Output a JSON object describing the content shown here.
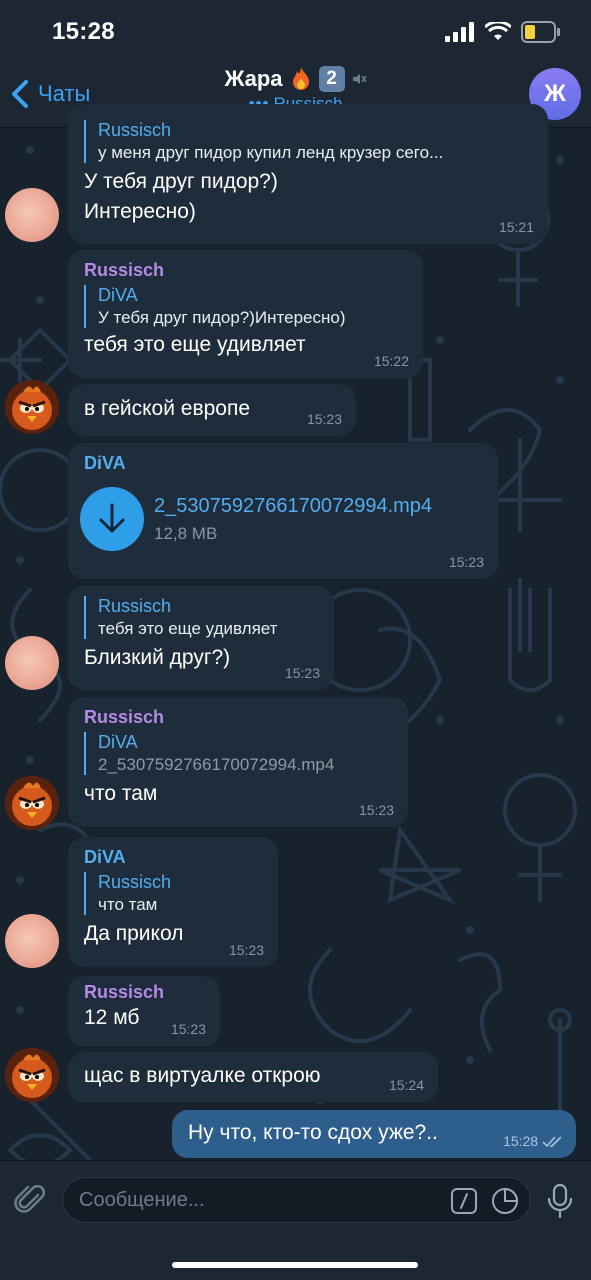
{
  "status": {
    "time": "15:28"
  },
  "header": {
    "back_label": "Чаты",
    "title": "Жара",
    "badge": "2",
    "typing_dots": "•••",
    "subtitle": "Russisch",
    "avatar_letter": "Ж"
  },
  "messages": [
    {
      "reply_name": "Russisch",
      "reply_text": "у меня друг пидор купил ленд крузер сего...",
      "text_line1": "У тебя друг пидор?)",
      "text_line2": "Интересно)",
      "time": "15:21"
    },
    {
      "sender": "Russisch",
      "reply_name": "DiVA",
      "reply_text": "У тебя друг пидор?)Интересно)",
      "text": "тебя это еще удивляет",
      "time": "15:22"
    },
    {
      "text": "в гейской европе",
      "time": "15:23"
    },
    {
      "sender": "DiVA",
      "file_name": "2_5307592766170072994.mp4",
      "file_size": "12,8 MB",
      "time": "15:23"
    },
    {
      "reply_name": "Russisch",
      "reply_text": "тебя это еще удивляет",
      "text": "Близкий друг?)",
      "time": "15:23"
    },
    {
      "sender": "Russisch",
      "reply_name": "DiVA",
      "reply_text": "2_5307592766170072994.mp4",
      "text": "что там",
      "time": "15:23"
    },
    {
      "sender": "DiVA",
      "reply_name": "Russisch",
      "reply_text": "что там",
      "text": "Да прикол",
      "time": "15:23"
    },
    {
      "sender": "Russisch",
      "text": "12 мб",
      "time": "15:23"
    },
    {
      "text": "щас в виртуалке открою",
      "time": "15:24"
    },
    {
      "text": "Ну что, кто-то сдох уже?..",
      "time": "15:28",
      "outgoing": true
    }
  ],
  "input": {
    "placeholder": "Сообщение..."
  },
  "colors": {
    "accent": "#3ea3f2",
    "incoming_bubble": "#1f2c3b",
    "outgoing_bubble": "#2e5e8c",
    "background": "#18222d"
  }
}
